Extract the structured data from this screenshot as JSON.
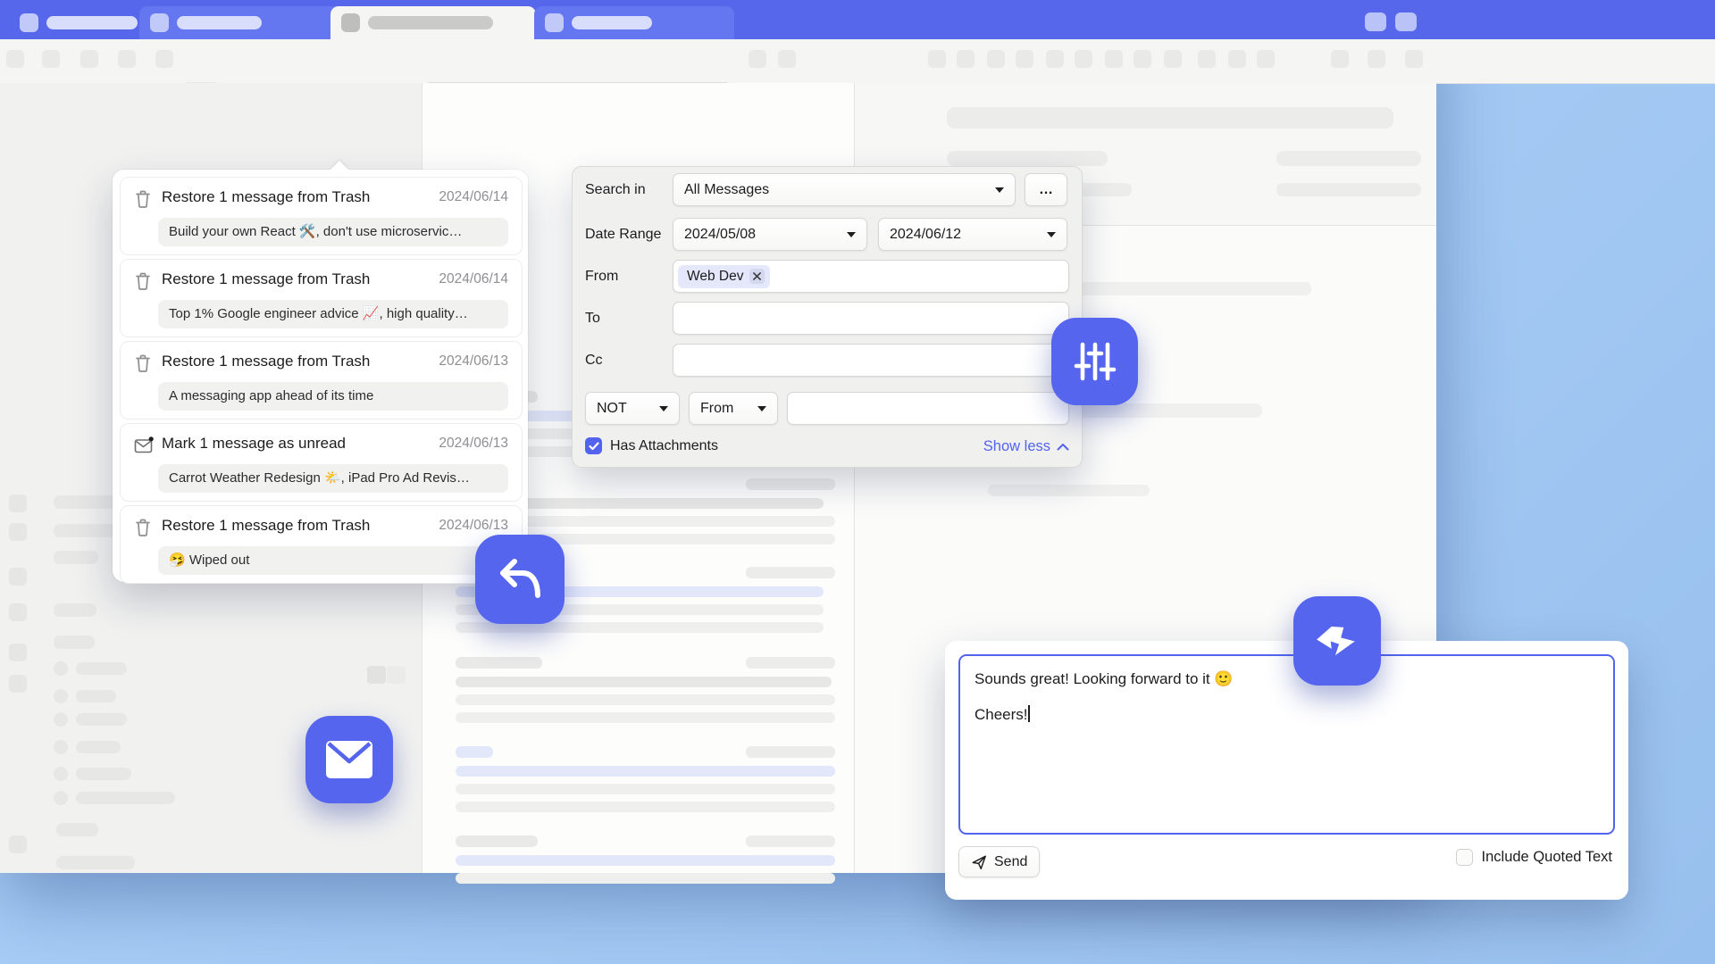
{
  "colors": {
    "accent": "#5463ee",
    "titlebar": "#5767ec",
    "fab": "#5565ee",
    "sky": "#a6cbf5"
  },
  "undo_popover": {
    "items": [
      {
        "icon": "trash-icon",
        "title": "Restore 1 message from Trash",
        "date": "2024/06/14",
        "subject": "Build your own React 🛠️, don't use microservic…"
      },
      {
        "icon": "trash-icon",
        "title": "Restore 1 message from Trash",
        "date": "2024/06/14",
        "subject": "Top 1% Google engineer advice 📈, high quality…"
      },
      {
        "icon": "trash-icon",
        "title": "Restore 1 message from Trash",
        "date": "2024/06/13",
        "subject": "A messaging app ahead of its time"
      },
      {
        "icon": "mark-unread-icon",
        "title": "Mark 1 message as unread",
        "date": "2024/06/13",
        "subject": "Carrot Weather Redesign 🌤️, iPad Pro Ad Revis…"
      },
      {
        "icon": "trash-icon",
        "title": "Restore 1 message from Trash",
        "date": "2024/06/13",
        "subject": "🤧 Wiped out"
      }
    ]
  },
  "search_panel": {
    "search_in_label": "Search in",
    "search_in_value": "All Messages",
    "more_button": "…",
    "date_range_label": "Date Range",
    "date_start": "2024/05/08",
    "date_end": "2024/06/12",
    "from_label": "From",
    "from_token": "Web Dev",
    "to_label": "To",
    "cc_label": "Cc",
    "operator_value": "NOT",
    "field_value": "From",
    "has_attachments_label": "Has Attachments",
    "has_attachments_checked": true,
    "show_less_label": "Show less"
  },
  "compose": {
    "line1": "Sounds great! Looking forward to it 🙂",
    "line2": "Cheers!",
    "send_label": "Send",
    "include_quoted_label": "Include Quoted Text",
    "include_quoted_checked": false
  }
}
